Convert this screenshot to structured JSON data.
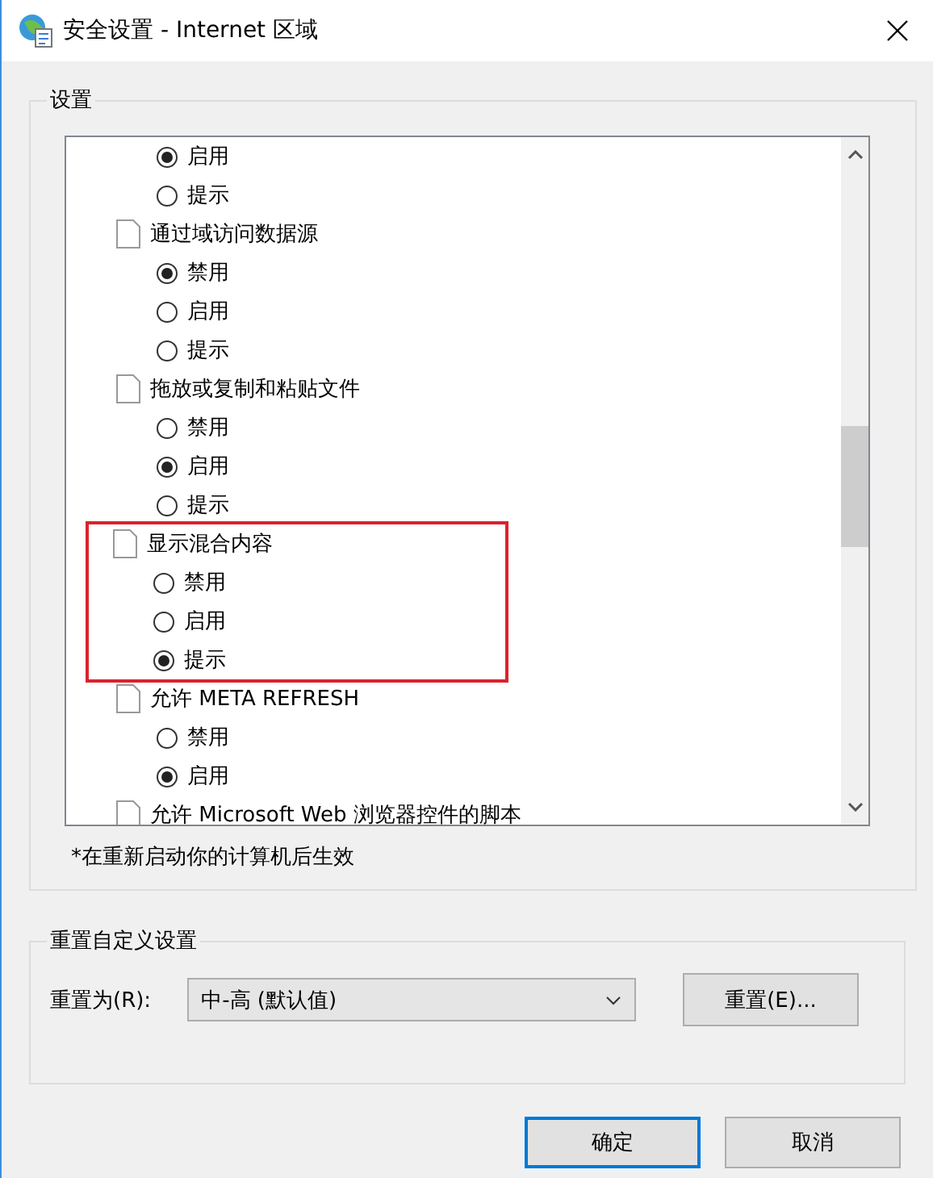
{
  "window": {
    "title": "安全设置 - Internet 区域"
  },
  "settings": {
    "label": "设置",
    "groups": [
      {
        "options": [
          {
            "label": "启用",
            "selected": true
          },
          {
            "label": "提示",
            "selected": false
          }
        ],
        "highlighted": false
      },
      {
        "title": "通过域访问数据源",
        "options": [
          {
            "label": "禁用",
            "selected": true
          },
          {
            "label": "启用",
            "selected": false
          },
          {
            "label": "提示",
            "selected": false
          }
        ],
        "highlighted": false
      },
      {
        "title": "拖放或复制和粘贴文件",
        "options": [
          {
            "label": "禁用",
            "selected": false
          },
          {
            "label": "启用",
            "selected": true
          },
          {
            "label": "提示",
            "selected": false
          }
        ],
        "highlighted": false
      },
      {
        "title": "显示混合内容",
        "options": [
          {
            "label": "禁用",
            "selected": false
          },
          {
            "label": "启用",
            "selected": false
          },
          {
            "label": "提示",
            "selected": true
          }
        ],
        "highlighted": true
      },
      {
        "title": "允许 META REFRESH",
        "options": [
          {
            "label": "禁用",
            "selected": false
          },
          {
            "label": "启用",
            "selected": true
          }
        ],
        "highlighted": false
      },
      {
        "title": "允许 Microsoft Web 浏览器控件的脚本",
        "highlighted": false
      }
    ],
    "note": "*在重新启动你的计算机后生效"
  },
  "reset": {
    "label": "重置自定义设置",
    "field_label": "重置为(R):",
    "value": "中-高 (默认值)",
    "button": "重置(E)..."
  },
  "buttons": [
    {
      "label": "确定",
      "default": true
    },
    {
      "label": "取消",
      "default": false
    }
  ]
}
